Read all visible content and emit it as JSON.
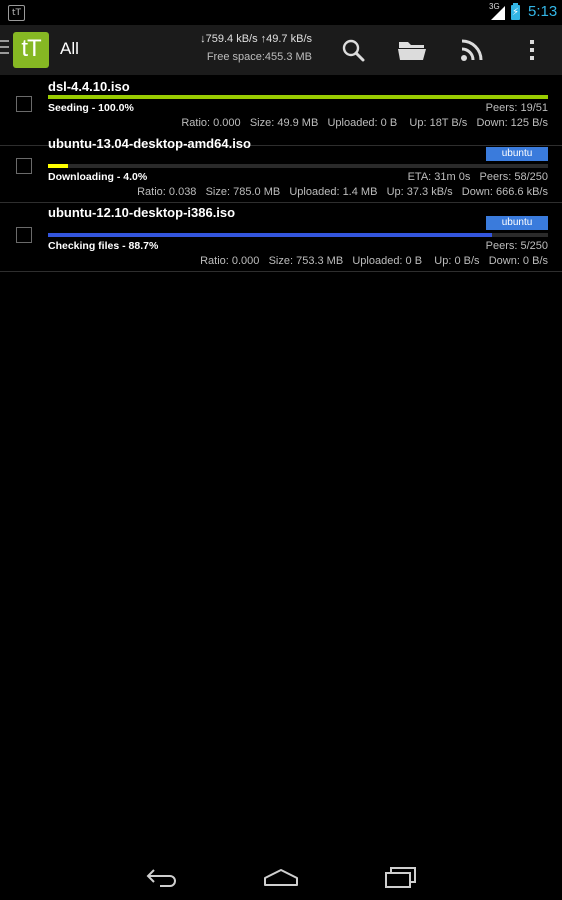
{
  "status_bar": {
    "app_icon_text": "tT",
    "network": "3G",
    "time": "5:13",
    "battery_color": "#33b5e5"
  },
  "action_bar": {
    "logo_text": "tT",
    "title": "All",
    "speed": "↓759.4 kB/s ↑49.7 kB/s",
    "free_space": "Free space:455.3 MB",
    "icons": [
      "search-icon",
      "folder-icon",
      "rss-icon",
      "overflow-menu-icon"
    ]
  },
  "torrents": [
    {
      "name": "dsl-4.4.10.iso",
      "status": "Seeding - 100.0%",
      "progress": 1.0,
      "bar_color": "#99cc00",
      "line1": "Peers: 19/51",
      "line2": "Ratio: 0.000   Size: 49.9 MB   Uploaded: 0 B    Up: 18T B/s   Down: 125 B/s",
      "label": ""
    },
    {
      "name": "ubuntu-13.04-desktop-amd64.iso",
      "status": "Downloading - 4.0%",
      "progress": 0.04,
      "bar_color": "#ffff00",
      "line1": "ETA: 31m 0s   Peers: 58/250",
      "line2": "Ratio: 0.038   Size: 785.0 MB   Uploaded: 1.4 MB   Up: 37.3 kB/s   Down: 666.6 kB/s",
      "label": "ubuntu"
    },
    {
      "name": "ubuntu-12.10-desktop-i386.iso",
      "status": "Checking files - 88.7%",
      "progress": 0.887,
      "bar_color": "#3355dd",
      "line1": "Peers: 5/250",
      "line2": "Ratio: 0.000   Size: 753.3 MB   Uploaded: 0 B    Up: 0 B/s   Down: 0 B/s",
      "label": "ubuntu"
    }
  ],
  "nav_bar": {
    "icons": [
      "back-icon",
      "home-icon",
      "recent-apps-icon"
    ]
  }
}
